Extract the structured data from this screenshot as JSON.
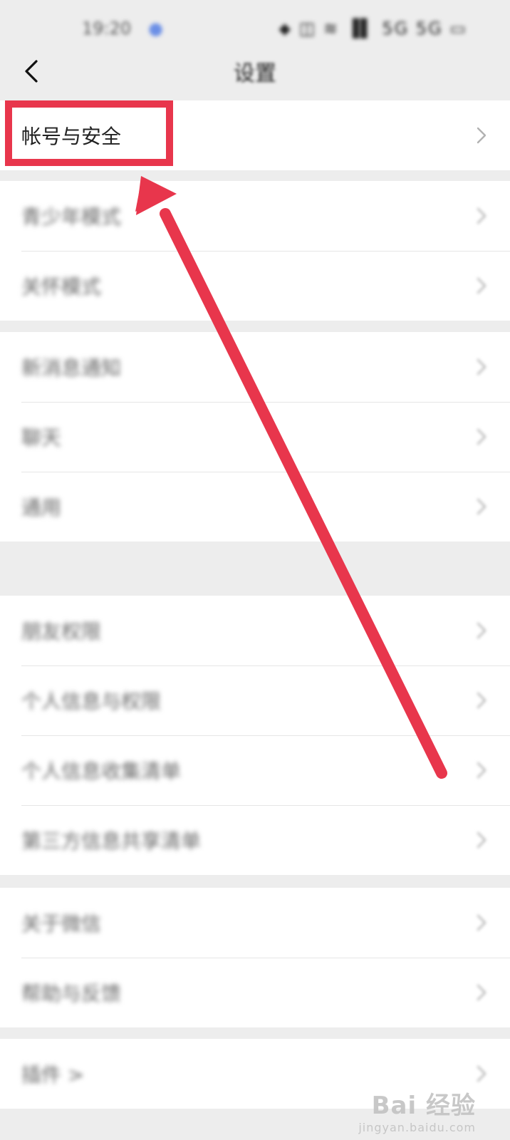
{
  "status_bar": {
    "time": "19:20",
    "indicators": "⬥ ◫ ≋ ▐▌ 5G 5G ▭"
  },
  "nav": {
    "title": "设置"
  },
  "section_title": "",
  "groups": [
    {
      "rows": [
        "帐号与安全"
      ]
    },
    {
      "rows": [
        "青少年模式",
        "关怀模式"
      ]
    },
    {
      "rows": [
        "新消息通知",
        "聊天",
        "通用"
      ]
    },
    {
      "rows": [
        "朋友权限",
        "个人信息与权限",
        "个人信息收集清单",
        "第三方信息共享清单"
      ]
    },
    {
      "rows": [
        "关于微信",
        "帮助与反馈"
      ]
    },
    {
      "rows": [
        "插件 >"
      ]
    }
  ],
  "colors": {
    "highlight": "#e8364c",
    "background": "#ededed"
  },
  "watermark": {
    "logo": "Bai 经验",
    "url": "jingyan.baidu.com"
  }
}
